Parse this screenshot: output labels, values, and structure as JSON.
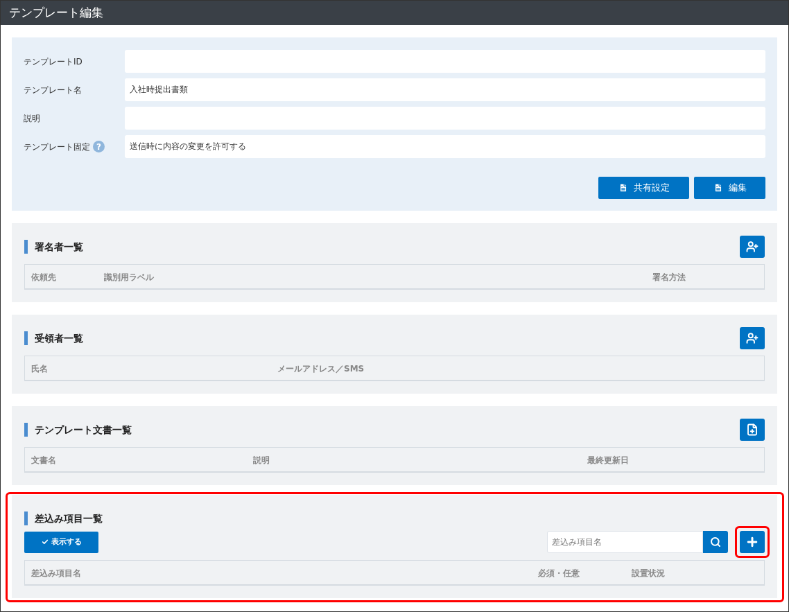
{
  "window": {
    "title": "テンプレート編集"
  },
  "form": {
    "fields": [
      {
        "label": "テンプレートID"
      },
      {
        "label": "テンプレート名",
        "value": "入社時提出書類"
      },
      {
        "label": "説明"
      },
      {
        "label": "テンプレート固定",
        "value": "送信時に内容の変更を許可する",
        "help": "?"
      }
    ],
    "buttons": [
      "共有設定",
      "編集"
    ]
  },
  "sections": [
    {
      "title": "署名者一覧",
      "kind": "person",
      "highlighted": false,
      "columns": [
        "依頼先",
        "識別用ラベル",
        "署名方法"
      ]
    },
    {
      "title": "受領者一覧",
      "kind": "person",
      "highlighted": false,
      "columns": [
        "氏名",
        "メールアドレス／SMS"
      ]
    },
    {
      "title": "テンプレート文書一覧",
      "kind": "file",
      "highlighted": false,
      "columns": [
        "文書名",
        "説明",
        "最終更新日"
      ]
    },
    {
      "title": "差込み項目一覧",
      "kind": "plus",
      "highlighted": true,
      "show_button": "表示する",
      "search": {
        "placeholder": "差込み項目名"
      },
      "add_highlighted": true,
      "columns": [
        "差込み項目名",
        "必須・任意",
        "設置状況"
      ]
    }
  ]
}
